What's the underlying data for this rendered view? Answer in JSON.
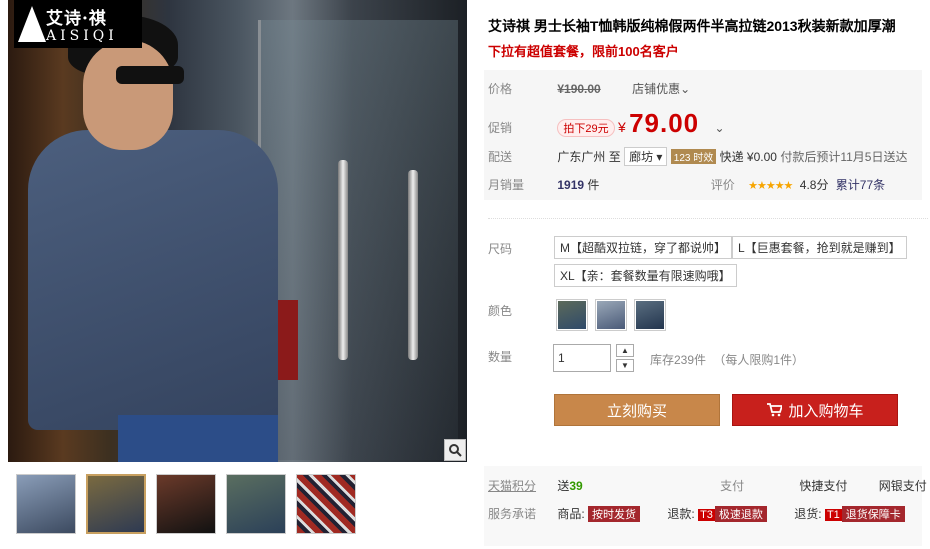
{
  "brand": {
    "cn": "艾诗·祺",
    "en": "AISIQI"
  },
  "product": {
    "title": "艾诗祺 男士长袖T恤韩版纯棉假两件半高拉链2013秋装新款加厚潮",
    "subtitle": "下拉有超值套餐，限前100名客户"
  },
  "price": {
    "label": "价格",
    "currency": "¥",
    "original": "190.00",
    "store_discount": "店铺优惠",
    "chevron": "⌄"
  },
  "promo": {
    "label": "促销",
    "tag": "拍下29元",
    "currency": "¥",
    "value": "79.00",
    "chevron": "⌄"
  },
  "shipping": {
    "label": "配送",
    "from": "广东广州",
    "to_word": "至",
    "dest": "廊坊",
    "badge": "123 时效",
    "express": "快递 ¥0.00",
    "note": "付款后预计11月5日送达"
  },
  "sales": {
    "label": "月销量",
    "count": "1919",
    "unit": "件",
    "rating_label": "评价",
    "stars": "★★★★★",
    "score": "4.8分",
    "reviews": "累计77条"
  },
  "size": {
    "label": "尺码",
    "options": [
      "M【超酷双拉链，穿了都说帅】",
      "L【巨惠套餐，抢到就是赚到】",
      "XL【亲：套餐数量有限速购哦】"
    ]
  },
  "color": {
    "label": "颜色"
  },
  "quantity": {
    "label": "数量",
    "value": "1",
    "stock": "库存239件",
    "limit": "（每人限购1件）"
  },
  "actions": {
    "buy": "立刻购买",
    "cart": "加入购物车"
  },
  "points": {
    "label": "天猫积分",
    "send": "送",
    "value": "39",
    "pay_label": "支付",
    "pay1": "快捷支付",
    "pay2": "网银支付"
  },
  "service": {
    "label": "服务承诺",
    "goods": "商品:",
    "goods_tag": "按时发货",
    "refund": "退款:",
    "refund_tag": "极速退款",
    "refund_badge": "T3",
    "return": "退货:",
    "return_tag": "退货保障卡",
    "return_badge": "T1"
  },
  "icons": {
    "zoom": "magnifier-icon",
    "cart": "cart-icon",
    "spin_up": "▲",
    "spin_down": "▼"
  },
  "colors": {
    "accent_red": "#c00",
    "buy_button": "#c8874a",
    "cart_button": "#c8201c"
  }
}
